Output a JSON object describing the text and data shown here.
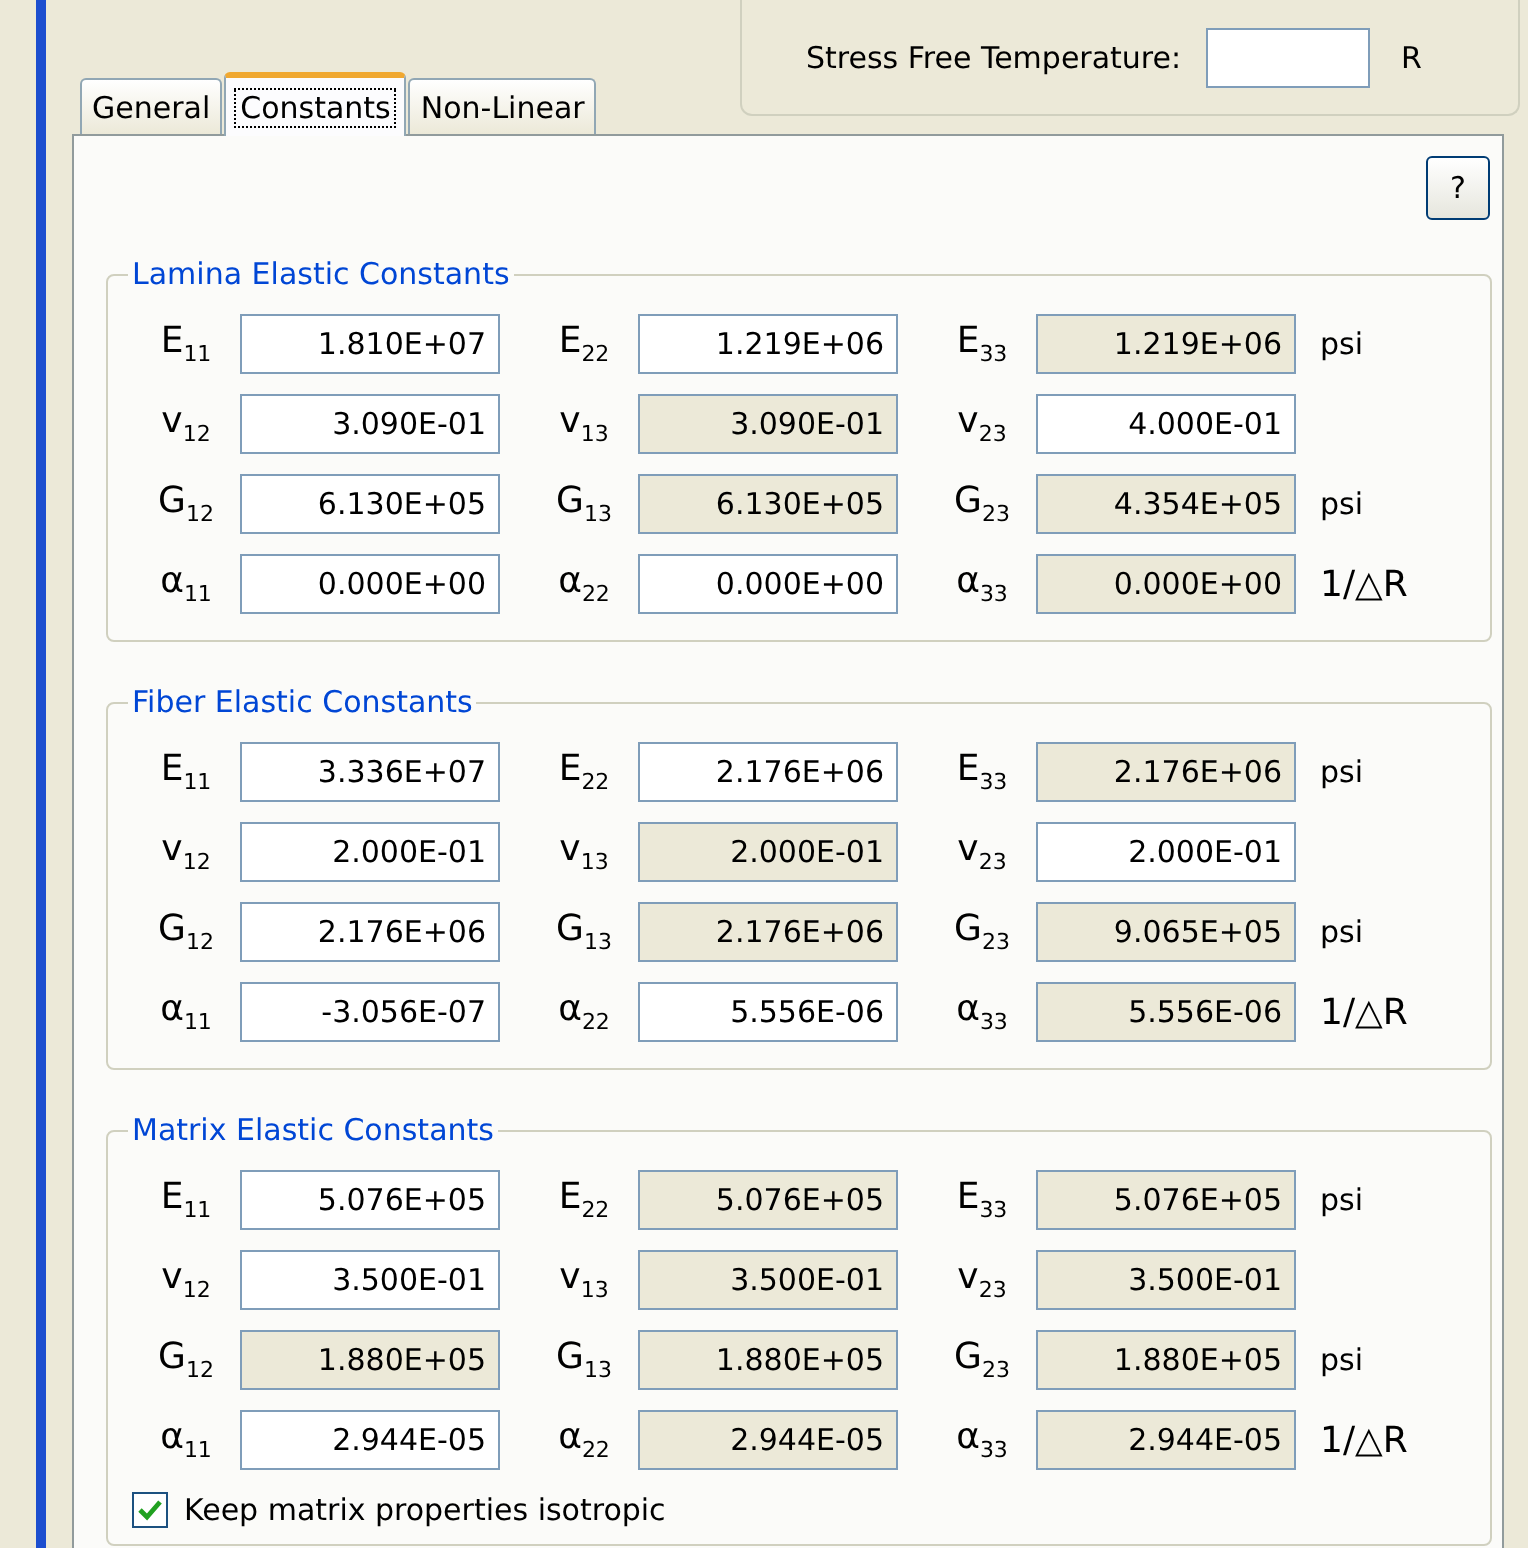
{
  "temperature": {
    "label": "Stress Free Temperature:",
    "unit": "R"
  },
  "tabs": [
    {
      "label": "General",
      "selected": false
    },
    {
      "label": "Constants",
      "selected": true
    },
    {
      "label": "Non-Linear",
      "selected": false
    }
  ],
  "help_button": "?",
  "groups": [
    {
      "title": "Lamina Elastic Constants",
      "rows": [
        {
          "unit": "psi",
          "cells": [
            {
              "label": "E$_{11}$",
              "value": "1.810E+07",
              "disabled": false
            },
            {
              "label": "E$_{22}$",
              "value": "1.219E+06",
              "disabled": false
            },
            {
              "label": "E$_{33}$",
              "value": "1.219E+06",
              "disabled": true
            }
          ]
        },
        {
          "cells": [
            {
              "label": "v$_{12}$",
              "value": "3.090E-01",
              "disabled": false
            },
            {
              "label": "v$_{13}$",
              "value": "3.090E-01",
              "disabled": true
            },
            {
              "label": "v$_{23}$",
              "value": "4.000E-01",
              "disabled": false
            }
          ]
        },
        {
          "unit": "psi",
          "cells": [
            {
              "label": "G$_{12}$",
              "value": "6.130E+05",
              "disabled": false
            },
            {
              "label": "G$_{13}$",
              "value": "6.130E+05",
              "disabled": true
            },
            {
              "label": "G$_{23}$",
              "value": "4.354E+05",
              "disabled": true
            }
          ]
        },
        {
          "unit": "1/△R",
          "cells": [
            {
              "label": "α$_{11}$",
              "value": "0.000E+00",
              "disabled": false
            },
            {
              "label": "α$_{22}$",
              "value": "0.000E+00",
              "disabled": false
            },
            {
              "label": "α$_{33}$",
              "value": "0.000E+00",
              "disabled": true
            }
          ]
        }
      ]
    },
    {
      "title": "Fiber Elastic Constants",
      "rows": [
        {
          "unit": "psi",
          "cells": [
            {
              "label": "E$_{11}$",
              "value": "3.336E+07",
              "disabled": false
            },
            {
              "label": "E$_{22}$",
              "value": "2.176E+06",
              "disabled": false
            },
            {
              "label": "E$_{33}$",
              "value": "2.176E+06",
              "disabled": true
            }
          ]
        },
        {
          "cells": [
            {
              "label": "v$_{12}$",
              "value": "2.000E-01",
              "disabled": false
            },
            {
              "label": "v$_{13}$",
              "value": "2.000E-01",
              "disabled": true
            },
            {
              "label": "v$_{23}$",
              "value": "2.000E-01",
              "disabled": false
            }
          ]
        },
        {
          "unit": "psi",
          "cells": [
            {
              "label": "G$_{12}$",
              "value": "2.176E+06",
              "disabled": false
            },
            {
              "label": "G$_{13}$",
              "value": "2.176E+06",
              "disabled": true
            },
            {
              "label": "G$_{23}$",
              "value": "9.065E+05",
              "disabled": true
            }
          ]
        },
        {
          "unit": "1/△R",
          "cells": [
            {
              "label": "α$_{11}$",
              "value": "-3.056E-07",
              "disabled": false
            },
            {
              "label": "α$_{22}$",
              "value": "5.556E-06",
              "disabled": false
            },
            {
              "label": "α$_{33}$",
              "value": "5.556E-06",
              "disabled": true
            }
          ]
        }
      ]
    },
    {
      "title": "Matrix Elastic Constants",
      "rows": [
        {
          "unit": "psi",
          "cells": [
            {
              "label": "E$_{11}$",
              "value": "5.076E+05",
              "disabled": false
            },
            {
              "label": "E$_{22}$",
              "value": "5.076E+05",
              "disabled": true
            },
            {
              "label": "E$_{33}$",
              "value": "5.076E+05",
              "disabled": true
            }
          ]
        },
        {
          "cells": [
            {
              "label": "v$_{12}$",
              "value": "3.500E-01",
              "disabled": false
            },
            {
              "label": "v$_{13}$",
              "value": "3.500E-01",
              "disabled": true
            },
            {
              "label": "v$_{23}$",
              "value": "3.500E-01",
              "disabled": true
            }
          ]
        },
        {
          "unit": "psi",
          "cells": [
            {
              "label": "G$_{12}$",
              "value": "1.880E+05",
              "disabled": true
            },
            {
              "label": "G$_{13}$",
              "value": "1.880E+05",
              "disabled": true
            },
            {
              "label": "G$_{23}$",
              "value": "1.880E+05",
              "disabled": true
            }
          ]
        },
        {
          "unit": "1/△R",
          "cells": [
            {
              "label": "α$_{11}$",
              "value": "2.944E-05",
              "disabled": false
            },
            {
              "label": "α$_{22}$",
              "value": "2.944E-05",
              "disabled": true
            },
            {
              "label": "α$_{33}$",
              "value": "2.944E-05",
              "disabled": true
            }
          ]
        }
      ],
      "checkbox": {
        "label": "Keep matrix properties isotropic",
        "checked": true
      }
    }
  ]
}
